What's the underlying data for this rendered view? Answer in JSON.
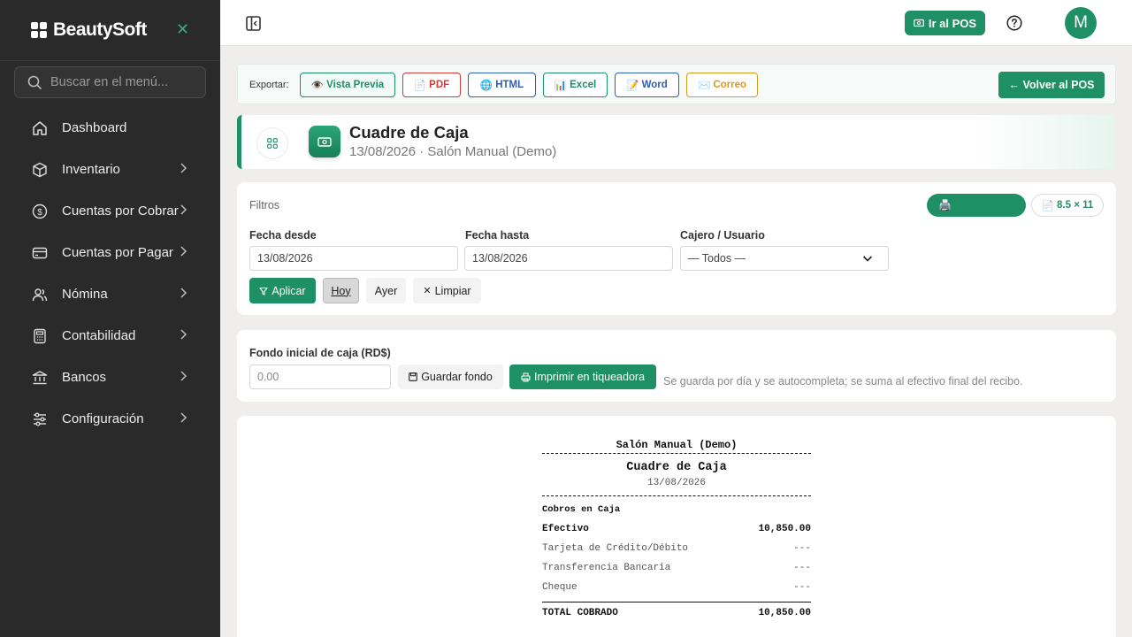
{
  "sidebar": {
    "brand": "BeautySoft",
    "search_placeholder": "Buscar en el menú...",
    "items": [
      {
        "label": "Dashboard"
      },
      {
        "label": "Inventario"
      },
      {
        "label": "Cuentas por Cobrar"
      },
      {
        "label": "Cuentas por Pagar"
      },
      {
        "label": "Nómina"
      },
      {
        "label": "Contabilidad"
      },
      {
        "label": "Bancos"
      },
      {
        "label": "Configuración"
      }
    ]
  },
  "topbar": {
    "pos_label": "Ir al POS",
    "avatar_initial": "M"
  },
  "export": {
    "label": "Exportar:",
    "buttons": [
      {
        "label": "Vista Previa",
        "icon": "👁️",
        "color": "#1f8f66"
      },
      {
        "label": "PDF",
        "icon": "📄",
        "color": "#d23a3a"
      },
      {
        "label": "HTML",
        "icon": "🌐",
        "color": "#2f5fb3"
      },
      {
        "label": "Excel",
        "icon": "📊",
        "color": "#1f8f66"
      },
      {
        "label": "Word",
        "icon": "📝",
        "color": "#2f5fb3"
      },
      {
        "label": "Correo",
        "icon": "✉️",
        "color": "#d99a1e"
      }
    ],
    "back_label": "← Volver al POS"
  },
  "header": {
    "title": "Cuadre de Caja",
    "subtitle": "13/08/2026 · Salón Manual (Demo)"
  },
  "filters": {
    "title": "Filtros",
    "page_size": "8.5 × 11",
    "fecha_desde_label": "Fecha desde",
    "fecha_desde_value": "13/08/2026",
    "fecha_hasta_label": "Fecha hasta",
    "fecha_hasta_value": "13/08/2026",
    "cajero_label": "Cajero / Usuario",
    "cajero_value": "— Todos —",
    "aplicar": "Aplicar",
    "hoy": "Hoy",
    "ayer": "Ayer",
    "limpiar": "Limpiar"
  },
  "fondo": {
    "label": "Fondo inicial de caja (RD$)",
    "placeholder": "0.00",
    "guardar": "Guardar fondo",
    "imprimir": "Imprimir en tiqueadora",
    "note": "Se guarda por día y se autocompleta; se suma al efectivo final del recibo."
  },
  "receipt": {
    "company": "Salón Manual (Demo)",
    "title": "Cuadre de Caja",
    "date": "13/08/2026",
    "section": "Cobros en Caja",
    "rows": [
      {
        "label": "Efectivo",
        "value": "10,850.00"
      },
      {
        "label": "Tarjeta de Crédito/Débito",
        "value": "---"
      },
      {
        "label": "Transferencia Bancaria",
        "value": "---"
      },
      {
        "label": "Cheque",
        "value": "---"
      }
    ],
    "total_label": "TOTAL COBRADO",
    "total_value": "10,850.00"
  },
  "colors": {
    "accent": "#1f8f66",
    "sidebar_bg": "#2a2a2a"
  }
}
